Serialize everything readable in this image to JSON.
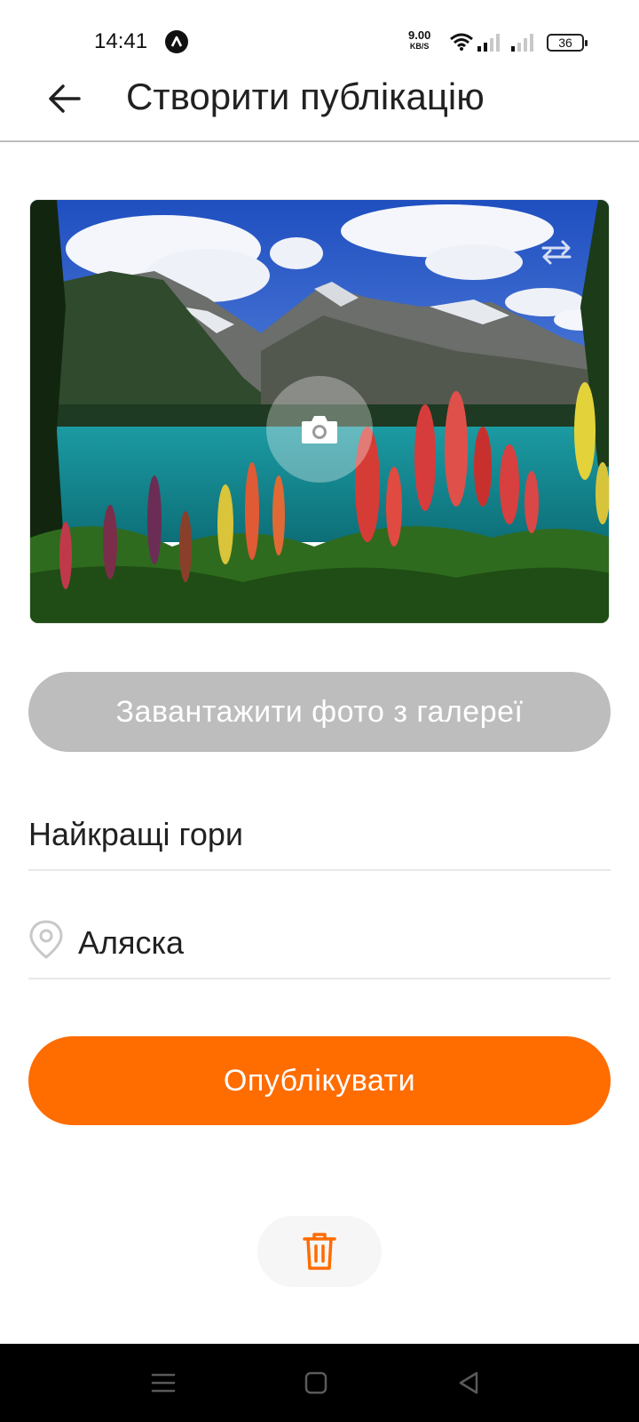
{
  "status_bar": {
    "time": "14:41",
    "net_speed_value": "9.00",
    "net_speed_unit": "KB/S",
    "battery": "36"
  },
  "header": {
    "title": "Створити публікацію"
  },
  "photo": {
    "description_icon": "camera-icon",
    "switch_icon": "repeat-arrows-icon"
  },
  "gallery_button": {
    "label": "Завантажити фото з галереї",
    "color": "#bdbdbd"
  },
  "form": {
    "title_value": "Найкращі гори",
    "location_value": "Аляска"
  },
  "publish_button": {
    "label": "Опублікувати",
    "color": "#ff6c00"
  },
  "delete_button": {
    "icon": "trash-icon",
    "color": "#ff6c00"
  },
  "nav_bar": {
    "items": [
      "menu-icon",
      "home-square-icon",
      "back-triangle-icon"
    ]
  }
}
